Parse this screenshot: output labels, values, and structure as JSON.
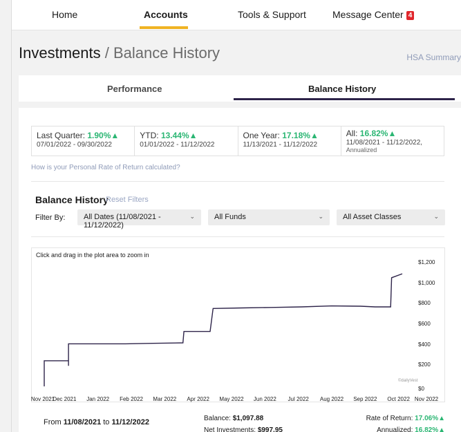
{
  "nav": {
    "items": [
      {
        "label": "Home",
        "active": false
      },
      {
        "label": "Accounts",
        "active": true
      },
      {
        "label": "Tools & Support",
        "active": false
      },
      {
        "label": "Message Center",
        "active": false,
        "badge": "4"
      }
    ],
    "accent_color": "#f0b323",
    "badge_color": "#e0262b"
  },
  "header": {
    "title": "Investments",
    "separator": "/",
    "subtitle": "Balance History",
    "link": "HSA Summary"
  },
  "tabs": [
    {
      "label": "Performance",
      "active": false
    },
    {
      "label": "Balance History",
      "active": true
    }
  ],
  "returns": [
    {
      "label": "Last Quarter:",
      "value": "1.90%",
      "range": "07/01/2022 - 09/30/2022",
      "note": ""
    },
    {
      "label": "YTD:",
      "value": "13.44%",
      "range": "01/01/2022 - 11/12/2022",
      "note": ""
    },
    {
      "label": "One Year:",
      "value": "17.18%",
      "range": "11/13/2021 - 11/12/2022",
      "note": ""
    },
    {
      "label": "All:",
      "value": "16.82%",
      "range": "11/08/2021 - 11/12/2022,",
      "note": "Annualized"
    }
  ],
  "calc_link": "How is your Personal Rate of Return calculated?",
  "balance_history": {
    "title": "Balance History",
    "reset": "Reset Filters",
    "filter_label": "Filter By:",
    "filters": [
      {
        "value": "All Dates (11/08/2021 - 11/12/2022)"
      },
      {
        "value": "All Funds"
      },
      {
        "value": "All Asset Classes"
      }
    ]
  },
  "chart_data": {
    "type": "line",
    "hint": "Click and drag in the plot area to zoom in",
    "credit": "©dailyVest",
    "x_tick_labels": [
      "Nov 2021",
      "Dec 2021",
      "Jan 2022",
      "Feb 2022",
      "Mar 2022",
      "Apr 2022",
      "May 2022",
      "Jun 2022",
      "Jul 2022",
      "Aug 2022",
      "Sep 2022",
      "Oct 2022",
      "Nov 2022"
    ],
    "y_tick_labels": [
      "$0",
      "$200",
      "$400",
      "$600",
      "$800",
      "$1,000",
      "$1,200"
    ],
    "ylim": [
      0,
      1200
    ],
    "xlim": [
      "2021-11-08",
      "2022-11-12"
    ],
    "line_color": "#2d2349",
    "x": [
      "2021-11-08",
      "2021-11-08",
      "2021-12-03",
      "2021-12-03",
      "2021-12-03",
      "2021-12-31",
      "2022-01-31",
      "2022-02-28",
      "2022-03-31",
      "2022-04-01",
      "2022-04-28",
      "2022-05-01",
      "2022-05-31",
      "2022-06-30",
      "2022-07-31",
      "2022-08-31",
      "2022-09-30",
      "2022-10-15",
      "2022-10-31",
      "2022-11-01",
      "2022-11-12"
    ],
    "y": [
      0,
      250,
      250,
      200,
      415,
      415,
      415,
      420,
      425,
      535,
      535,
      760,
      765,
      770,
      775,
      785,
      782,
      775,
      775,
      1060,
      1098
    ]
  },
  "summary": {
    "from_label": "From",
    "from_date": "11/08/2021",
    "to_label": "to",
    "to_date": "11/12/2022",
    "balance_label": "Balance:",
    "balance": "$1,097.88",
    "net_label": "Net Investments:",
    "net": "$997.95",
    "ror_label": "Rate of Return:",
    "ror": "17.06%",
    "ann_label": "Annualized:",
    "ann": "16.82%",
    "positive_color": "#2bb673"
  }
}
